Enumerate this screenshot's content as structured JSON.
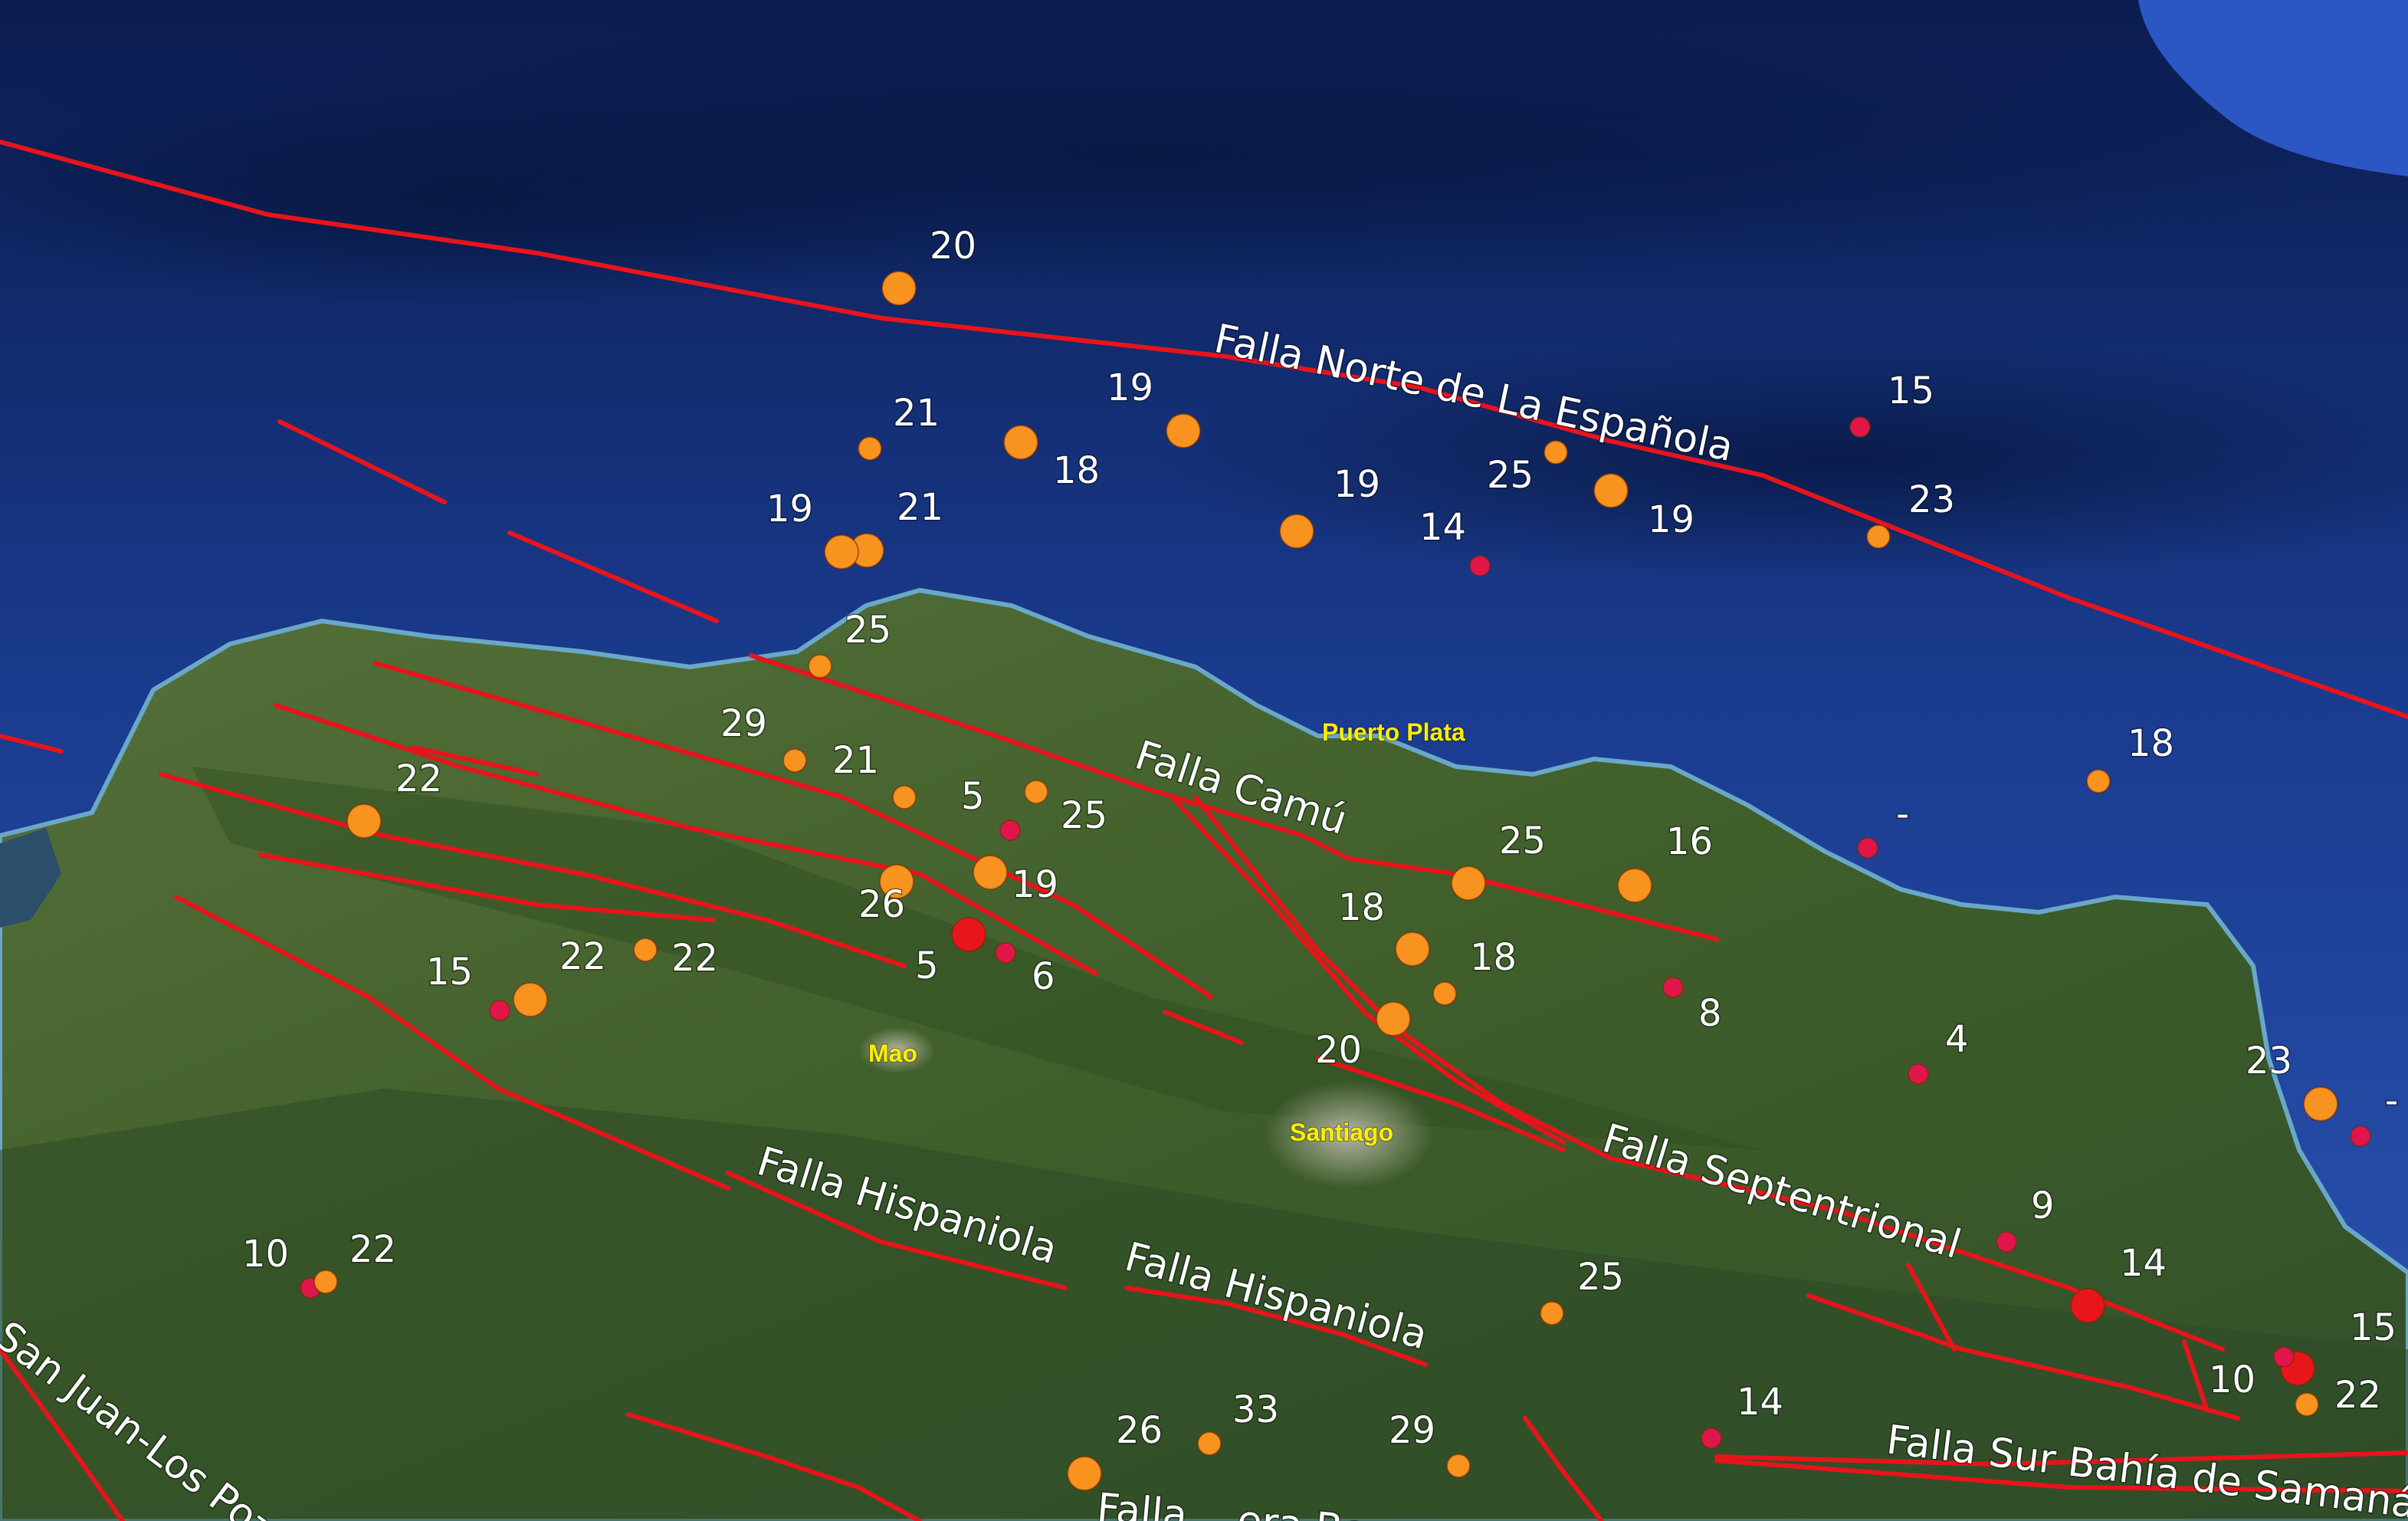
{
  "colors": {
    "fault": "#e8141b",
    "eq_shallow": "#f7931e",
    "eq_mid": "#e0164a",
    "eq_strong": "#e8151b",
    "city_label": "#ffee00",
    "ocean_deep": "#0c1f57",
    "ocean_shelf": "#2c56b8",
    "land": "#3e5f2b"
  },
  "faults": [
    {
      "label": "Falla Norte de La Española"
    },
    {
      "label": "Falla Camú"
    },
    {
      "label": "Falla Septentrional"
    },
    {
      "label": "Falla Hispaniola"
    },
    {
      "label": "Falla Hispaniola"
    },
    {
      "label": "Falla Sur Bahía de Samaná"
    },
    {
      "label": "San Juan-Los Pozos"
    },
    {
      "label": "Falla ...era Bonao"
    }
  ],
  "cities": [
    {
      "name": "Puerto Plata"
    },
    {
      "name": "Mao"
    },
    {
      "name": "Santiago"
    }
  ],
  "earthquakes": [
    {
      "label": "20",
      "type": "shallow"
    },
    {
      "label": "21",
      "type": "shallow"
    },
    {
      "label": "18",
      "type": "shallow"
    },
    {
      "label": "19",
      "type": "shallow"
    },
    {
      "label": "19",
      "type": "shallow"
    },
    {
      "label": "21",
      "type": "shallow"
    },
    {
      "label": "19",
      "type": "shallow"
    },
    {
      "label": "25",
      "type": "shallow"
    },
    {
      "label": "19",
      "type": "shallow"
    },
    {
      "label": "14",
      "type": "mid"
    },
    {
      "label": "15",
      "type": "mid"
    },
    {
      "label": "23",
      "type": "shallow"
    },
    {
      "label": "25",
      "type": "shallow"
    },
    {
      "label": "29",
      "type": "shallow"
    },
    {
      "label": "21",
      "type": "shallow"
    },
    {
      "label": "5",
      "type": "mid"
    },
    {
      "label": "25",
      "type": "shallow"
    },
    {
      "label": "22",
      "type": "shallow"
    },
    {
      "label": "19",
      "type": "shallow"
    },
    {
      "label": "26",
      "type": "shallow"
    },
    {
      "label": "5",
      "type": "strong"
    },
    {
      "label": "6",
      "type": "mid"
    },
    {
      "label": "22",
      "type": "shallow"
    },
    {
      "label": "22",
      "type": "shallow"
    },
    {
      "label": "15",
      "type": "mid"
    },
    {
      "label": "25",
      "type": "shallow"
    },
    {
      "label": "16",
      "type": "shallow"
    },
    {
      "label": "18",
      "type": "shallow"
    },
    {
      "label": "18",
      "type": "shallow"
    },
    {
      "label": "20",
      "type": "shallow"
    },
    {
      "label": "8",
      "type": "mid"
    },
    {
      "label": "18",
      "type": "shallow"
    },
    {
      "label": "-",
      "type": "mid"
    },
    {
      "label": "4",
      "type": "mid"
    },
    {
      "label": "23",
      "type": "shallow"
    },
    {
      "label": "-",
      "type": "mid"
    },
    {
      "label": "9",
      "type": "mid"
    },
    {
      "label": "14",
      "type": "strong"
    },
    {
      "label": "15",
      "type": "strong"
    },
    {
      "label": "10",
      "type": "mid"
    },
    {
      "label": "22",
      "type": "shallow"
    },
    {
      "label": "14",
      "type": "mid"
    },
    {
      "label": "10",
      "type": "mid"
    },
    {
      "label": "22",
      "type": "shallow"
    },
    {
      "label": "25",
      "type": "shallow"
    },
    {
      "label": "26",
      "type": "shallow"
    },
    {
      "label": "33",
      "type": "shallow"
    },
    {
      "label": "29",
      "type": "shallow"
    }
  ]
}
